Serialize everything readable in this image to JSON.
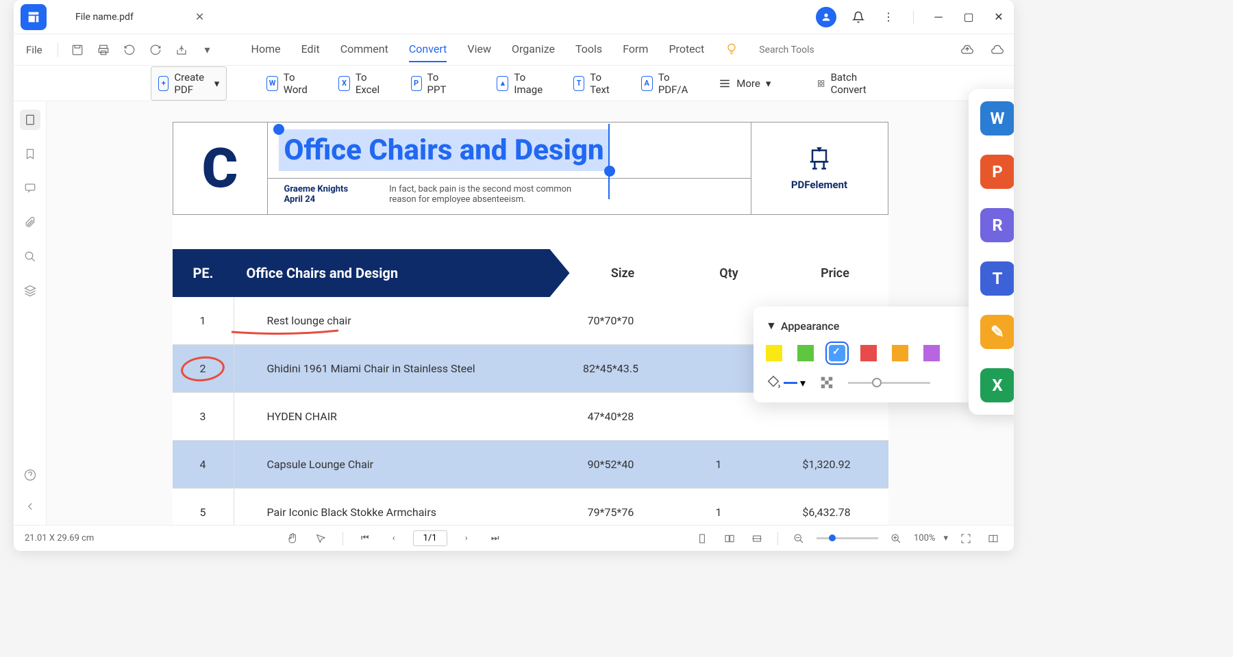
{
  "titlebar": {
    "tab_name": "File name.pdf"
  },
  "menubar": {
    "file": "File",
    "items": [
      "Home",
      "Edit",
      "Comment",
      "Convert",
      "View",
      "Organize",
      "Tools",
      "Form",
      "Protect"
    ],
    "active_index": 3,
    "search_placeholder": "Search Tools"
  },
  "toolbar": {
    "create_pdf": "Create PDF",
    "to_word": "To Word",
    "to_excel": "To Excel",
    "to_ppt": "To PPT",
    "to_image": "To Image",
    "to_text": "To Text",
    "to_pdfa": "To PDF/A",
    "more": "More",
    "batch_convert": "Batch Convert"
  },
  "document": {
    "title": "Office Chairs and Design",
    "author": "Graeme Knights",
    "date": "April 24",
    "description": "In fact, back pain is the second most common reason for employee absenteeism.",
    "brand": "PDFelement",
    "table_header": {
      "pe": "PE.",
      "title": "Office Chairs and Design",
      "size": "Size",
      "qty": "Qty",
      "price": "Price"
    },
    "rows": [
      {
        "num": "1",
        "name": "Rest lounge chair",
        "size": "70*70*70",
        "qty": "",
        "price": ""
      },
      {
        "num": "2",
        "name": "Ghidini 1961 Miami Chair in Stainless Steel",
        "size": "82*45*43.5",
        "qty": "",
        "price": ""
      },
      {
        "num": "3",
        "name": "HYDEN CHAIR",
        "size": "47*40*28",
        "qty": "",
        "price": ""
      },
      {
        "num": "4",
        "name": "Capsule Lounge Chair",
        "size": "90*52*40",
        "qty": "1",
        "price": "$1,320.92"
      },
      {
        "num": "5",
        "name": "Pair Iconic Black Stokke Armchairs",
        "size": "79*75*76",
        "qty": "1",
        "price": "$6,432.78"
      }
    ]
  },
  "appearance_panel": {
    "title": "Appearance",
    "colors": [
      "#f9e814",
      "#5fc63f",
      "#4b9eff",
      "#e94b4b",
      "#f5a623",
      "#b866e0"
    ],
    "selected_index": 2
  },
  "statusbar": {
    "dimensions": "21.01 X 29.69 cm",
    "page": "1/1",
    "zoom": "100%"
  },
  "dock_tiles": [
    {
      "letter": "W",
      "color": "#2b7cd3"
    },
    {
      "letter": "P",
      "color": "#e8572b"
    },
    {
      "letter": "R",
      "color": "#7165e0"
    },
    {
      "letter": "T",
      "color": "#3d62d8"
    },
    {
      "letter": "✎",
      "color": "#f5a623"
    },
    {
      "letter": "X",
      "color": "#1f9e55"
    }
  ]
}
